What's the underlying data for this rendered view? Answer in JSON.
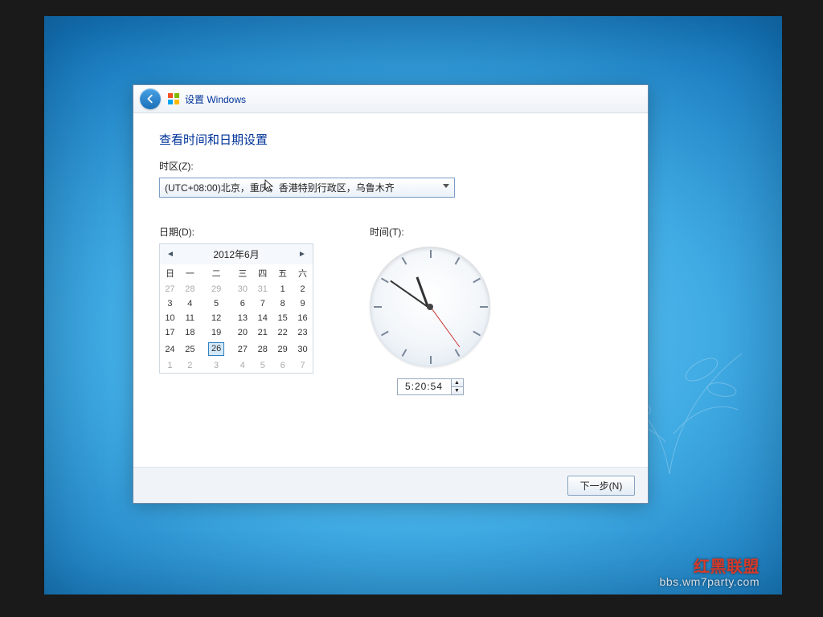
{
  "header": {
    "title": "设置 Windows"
  },
  "body": {
    "title": "查看时间和日期设置",
    "tz_label": "时区(Z):",
    "tz_value": "(UTC+08:00)北京，重庆，香港特别行政区，乌鲁木齐",
    "date_label": "日期(D):",
    "time_label": "时间(T):",
    "time_value": "5:20:54"
  },
  "calendar": {
    "month_title": "2012年6月",
    "weekdays": [
      "日",
      "一",
      "二",
      "三",
      "四",
      "五",
      "六"
    ],
    "rows": [
      [
        {
          "d": "27",
          "o": true
        },
        {
          "d": "28",
          "o": true
        },
        {
          "d": "29",
          "o": true
        },
        {
          "d": "30",
          "o": true
        },
        {
          "d": "31",
          "o": true
        },
        {
          "d": "1"
        },
        {
          "d": "2"
        }
      ],
      [
        {
          "d": "3"
        },
        {
          "d": "4"
        },
        {
          "d": "5"
        },
        {
          "d": "6"
        },
        {
          "d": "7"
        },
        {
          "d": "8"
        },
        {
          "d": "9"
        }
      ],
      [
        {
          "d": "10"
        },
        {
          "d": "11"
        },
        {
          "d": "12"
        },
        {
          "d": "13"
        },
        {
          "d": "14"
        },
        {
          "d": "15"
        },
        {
          "d": "16"
        }
      ],
      [
        {
          "d": "17"
        },
        {
          "d": "18"
        },
        {
          "d": "19"
        },
        {
          "d": "20"
        },
        {
          "d": "21"
        },
        {
          "d": "22"
        },
        {
          "d": "23"
        }
      ],
      [
        {
          "d": "24"
        },
        {
          "d": "25"
        },
        {
          "d": "26",
          "sel": true
        },
        {
          "d": "27"
        },
        {
          "d": "28"
        },
        {
          "d": "29"
        },
        {
          "d": "30"
        }
      ],
      [
        {
          "d": "1",
          "o": true
        },
        {
          "d": "2",
          "o": true
        },
        {
          "d": "3",
          "o": true
        },
        {
          "d": "4",
          "o": true
        },
        {
          "d": "5",
          "o": true
        },
        {
          "d": "6",
          "o": true
        },
        {
          "d": "7",
          "o": true
        }
      ]
    ]
  },
  "footer": {
    "next": "下一步(N)"
  },
  "watermark": {
    "logo": "红黑联盟",
    "line": "bbs.wm7party.com"
  }
}
